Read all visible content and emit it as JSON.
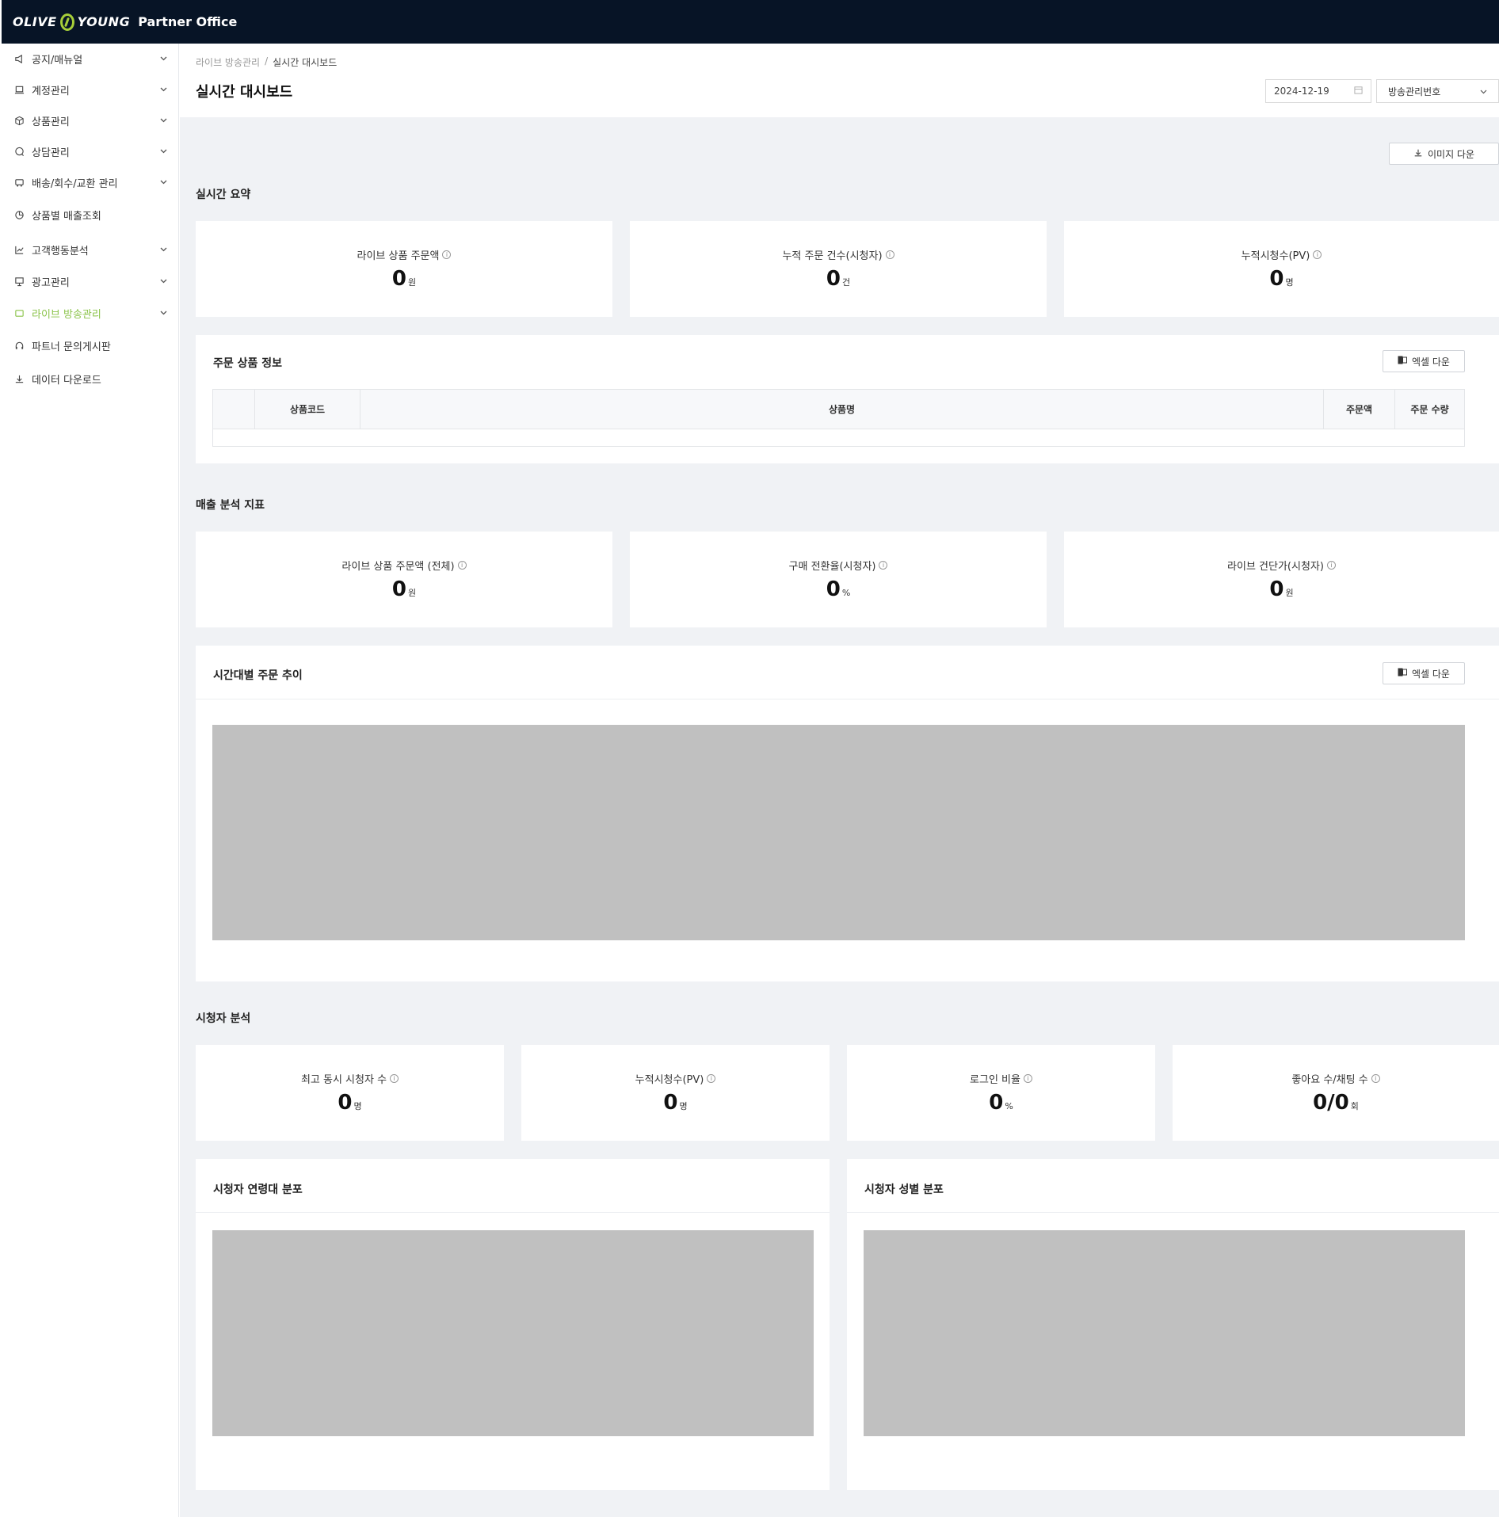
{
  "header": {
    "logo_left": "OLIVE",
    "logo_right": "YOUNG",
    "product": "Partner Office"
  },
  "sidebar": {
    "items": [
      {
        "label": "공지/매뉴얼",
        "icon": "megaphone-icon",
        "has_children": true
      },
      {
        "label": "계정관리",
        "icon": "laptop-icon",
        "has_children": true
      },
      {
        "label": "상품관리",
        "icon": "box-icon",
        "has_children": true
      },
      {
        "label": "상담관리",
        "icon": "chat-icon",
        "has_children": true
      },
      {
        "label": "배송/회수/교환 관리",
        "icon": "truck-icon",
        "has_children": true
      },
      {
        "label": "상품별 매출조회",
        "icon": "pie-chart-icon",
        "has_children": false
      },
      {
        "label": "고객행동분석",
        "icon": "line-chart-icon",
        "has_children": true
      },
      {
        "label": "광고관리",
        "icon": "presentation-icon",
        "has_children": true
      },
      {
        "label": "라이브 방송관리",
        "icon": "live-icon",
        "has_children": true,
        "active": true
      },
      {
        "label": "파트너 문의게시판",
        "icon": "headset-icon",
        "has_children": false
      },
      {
        "label": "데이터 다운로드",
        "icon": "download-icon",
        "has_children": false
      }
    ],
    "active_color": "#8bc34a"
  },
  "page": {
    "breadcrumb_parent": "라이브 방송관리",
    "breadcrumb_sep": "/",
    "breadcrumb_current": "실시간 대시보드",
    "title": "실시간 대시보드",
    "date_value": "2024-12-19",
    "broadcast_select": "방송관리번호",
    "image_download": "이미지 다운"
  },
  "summary": {
    "title": "실시간 요약",
    "cards": [
      {
        "label": "라이브 상품 주문액",
        "value": "0",
        "unit": "원"
      },
      {
        "label": "누적 주문 건수(시청자)",
        "value": "0",
        "unit": "건"
      },
      {
        "label": "누적시청수(PV)",
        "value": "0",
        "unit": "명"
      }
    ]
  },
  "order_info": {
    "title": "주문 상품 정보",
    "excel_button": "엑셀 다운",
    "columns": [
      "",
      "상품코드",
      "상품명",
      "주문액",
      "주문 수량"
    ]
  },
  "sales": {
    "title": "매출 분석 지표",
    "cards": [
      {
        "label": "라이브 상품 주문액 (전체)",
        "value": "0",
        "unit": "원"
      },
      {
        "label": "구매 전환율(시청자)",
        "value": "0",
        "unit": "%"
      },
      {
        "label": "라이브 건단가(시청자)",
        "value": "0",
        "unit": "원"
      }
    ]
  },
  "hourly": {
    "title": "시간대별 주문 추이",
    "excel_button": "엑셀 다운"
  },
  "viewers": {
    "title": "시청자 분석",
    "cards": [
      {
        "label": "최고 동시 시청자 수",
        "value": "0",
        "unit": "명"
      },
      {
        "label": "누적시청수(PV)",
        "value": "0",
        "unit": "명"
      },
      {
        "label": "로그인 비율",
        "value": "0",
        "unit": "%"
      },
      {
        "label": "좋아요 수/채팅 수",
        "value": "0/0",
        "unit": "회"
      }
    ],
    "age_title": "시청자 연령대 분포",
    "gender_title": "시청자 성별 분포"
  },
  "colors": {
    "header_bg": "#071426",
    "brand_green": "#a6ce39",
    "placeholder": "#c0c0c0"
  }
}
